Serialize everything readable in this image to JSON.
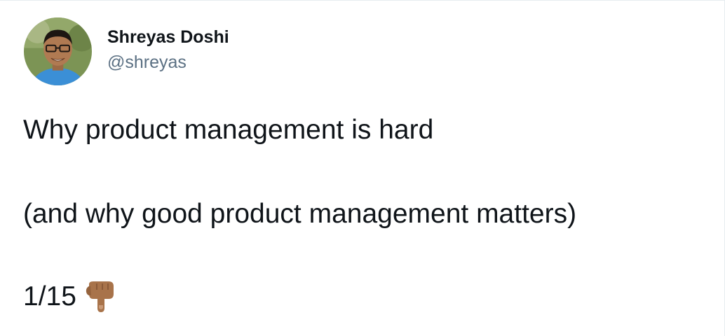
{
  "author": {
    "display_name": "Shreyas Doshi",
    "handle": "@shreyas"
  },
  "avatar": {
    "icon": "profile-photo-avatar",
    "background_color": "#6f8a4a",
    "skin_color": "#b07a52",
    "shirt_color": "#3b8fd6"
  },
  "tweet": {
    "line_1": "Why product management is hard",
    "line_2": "(and why good product management matters)",
    "line_3": "1/15",
    "emoji_icon": "backhand-index-pointing-down-medium-skin-tone",
    "emoji_color": "#a8734a"
  },
  "colors": {
    "text_primary": "#0f1419",
    "text_secondary": "#5b7083",
    "border": "#e6ecf0"
  }
}
